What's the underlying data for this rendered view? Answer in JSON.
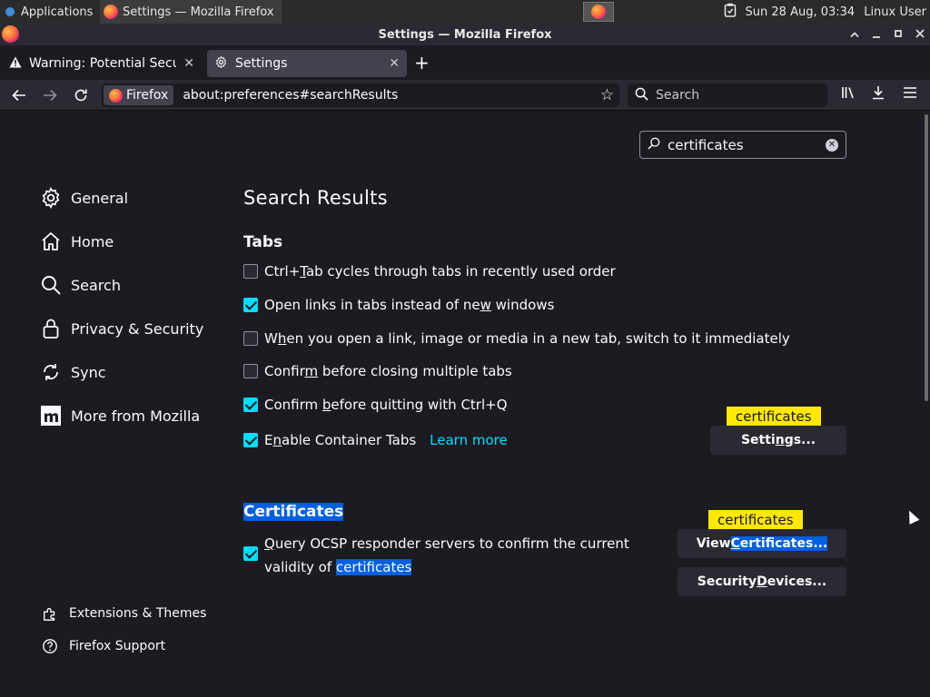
{
  "taskbar": {
    "applications": "Applications",
    "window": "Settings — Mozilla Firefox",
    "clock": "Sun 28 Aug, 03:34",
    "user": "Linux User"
  },
  "window": {
    "title": "Settings — Mozilla Firefox"
  },
  "tabs": [
    {
      "label": "Warning: Potential Security Risk Ahead"
    },
    {
      "label": "Settings"
    }
  ],
  "nav": {
    "identity": "Firefox",
    "url": "about:preferences#searchResults",
    "search_placeholder": "Search"
  },
  "find": {
    "value": "certificates"
  },
  "sidebar": {
    "items": [
      {
        "label": "General"
      },
      {
        "label": "Home"
      },
      {
        "label": "Search"
      },
      {
        "label": "Privacy & Security"
      },
      {
        "label": "Sync"
      },
      {
        "label": "More from Mozilla"
      }
    ],
    "footer": [
      {
        "label": "Extensions & Themes"
      },
      {
        "label": "Firefox Support"
      }
    ]
  },
  "main": {
    "heading": "Search Results",
    "tabs_section": {
      "title": "Tabs",
      "options": [
        {
          "pre": "Ctrl+",
          "key": "T",
          "post": "ab cycles through tabs in recently used order",
          "checked": false
        },
        {
          "pre": "Open links in tabs instead of ne",
          "key": "w",
          "post": " windows",
          "checked": true
        },
        {
          "pre": "W",
          "key": "h",
          "post": "en you open a link, image or media in a new tab, switch to it immediately",
          "checked": false
        },
        {
          "pre": "Confir",
          "key": "m",
          "post": " before closing multiple tabs",
          "checked": false
        },
        {
          "pre": "Confirm ",
          "key": "b",
          "post": "efore quitting with Ctrl+Q",
          "checked": true
        },
        {
          "pre": "E",
          "key": "n",
          "post": "able Container Tabs",
          "checked": true
        }
      ],
      "learn_more": "Learn more",
      "settings_button": {
        "pre": "Setti",
        "key": "n",
        "post": "gs..."
      },
      "tooltip": "certificates"
    },
    "certificates_section": {
      "title": "Certificates",
      "ocsp_key": "Q",
      "ocsp_line1": "uery OCSP responder servers to confirm the current",
      "ocsp_line2_pre": "validity of ",
      "ocsp_line2_hl": "certificates",
      "ocsp_checked": true,
      "view_button": {
        "pre": "View ",
        "key": "C",
        "post": "ertificates..."
      },
      "devices_button": {
        "pre": "Security ",
        "key": "D",
        "post": "evices..."
      },
      "tooltip": "certificates"
    }
  },
  "colors": {
    "accent": "#00ddff",
    "highlight": "#0060df",
    "tooltip": "#ffe900"
  }
}
